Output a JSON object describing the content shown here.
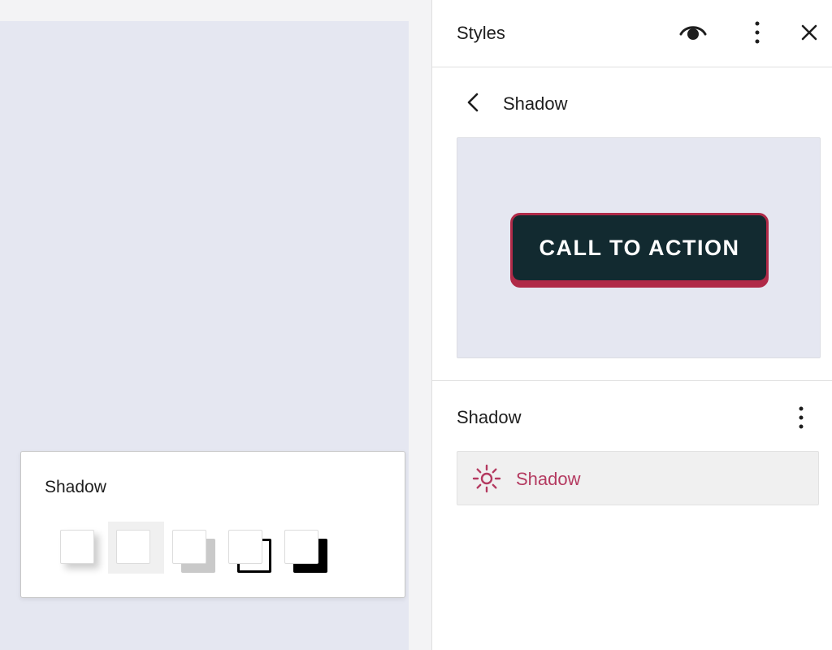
{
  "canvas": {
    "popover": {
      "title": "Shadow",
      "presets": [
        {
          "name": "natural"
        },
        {
          "name": "none"
        },
        {
          "name": "sharp"
        },
        {
          "name": "outlined"
        },
        {
          "name": "crisp"
        }
      ]
    }
  },
  "sidebar": {
    "title": "Styles",
    "header_icons": [
      "eye-icon",
      "more-vertical-icon",
      "close-icon"
    ],
    "nav": {
      "back_icon": "chevron-left-icon",
      "title": "Shadow"
    },
    "preview": {
      "button_label": "CALL TO ACTION",
      "bg_color": "#122a30",
      "accent_color": "#b02a48"
    },
    "section": {
      "title": "Shadow",
      "item_label": "Shadow",
      "item_icon": "sun-icon",
      "item_color": "#b43a60"
    }
  }
}
